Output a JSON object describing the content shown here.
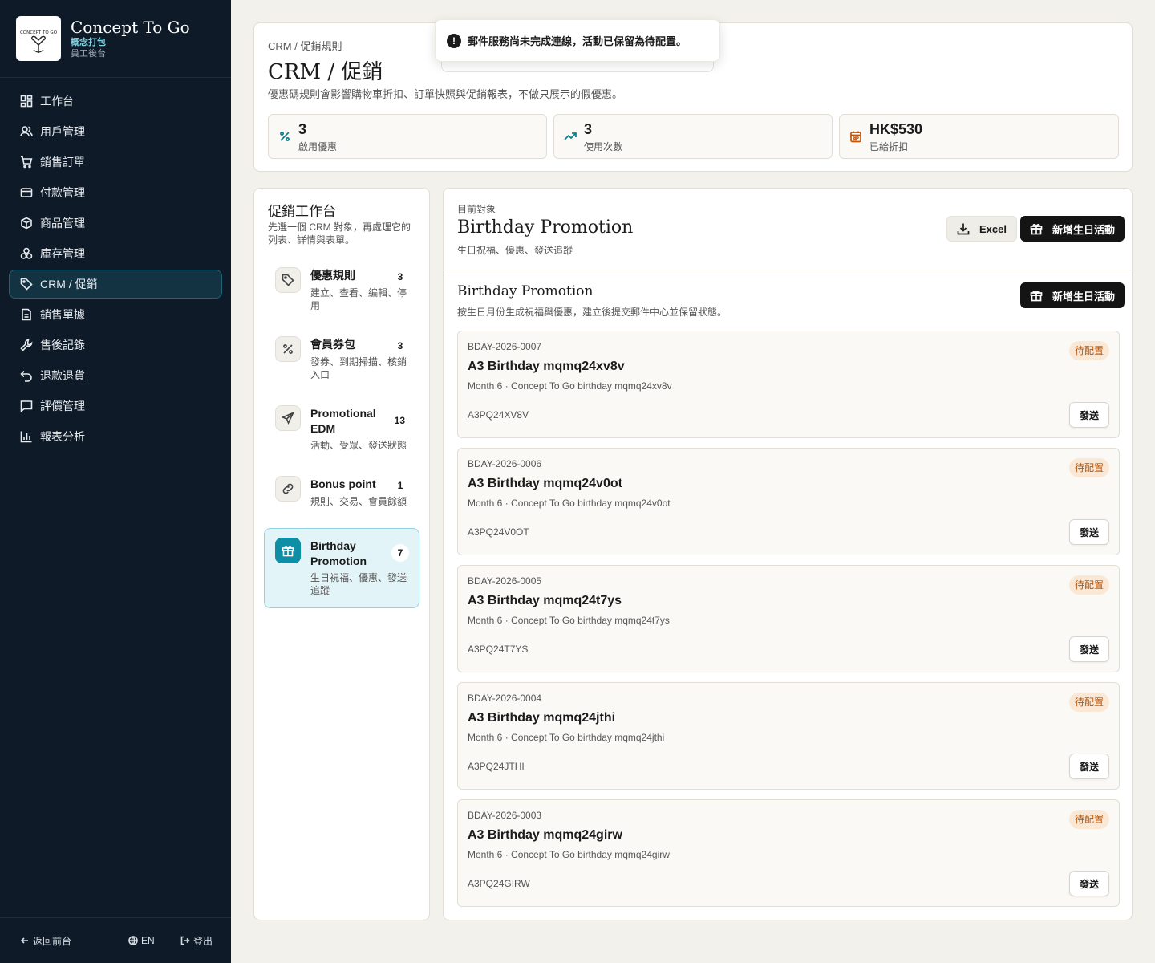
{
  "brand": {
    "name": "Concept To Go",
    "cn": "概念打包",
    "sub": "員工後台",
    "logo_text": "CONCEPT TO GO"
  },
  "nav": [
    {
      "label": "工作台",
      "icon": "dashboard-icon"
    },
    {
      "label": "用戶管理",
      "icon": "users-icon"
    },
    {
      "label": "銷售訂單",
      "icon": "cart-icon"
    },
    {
      "label": "付款管理",
      "icon": "credit-card-icon"
    },
    {
      "label": "商品管理",
      "icon": "box-icon"
    },
    {
      "label": "庫存管理",
      "icon": "boxes-icon"
    },
    {
      "label": "CRM / 促銷",
      "icon": "tag-icon",
      "active": true
    },
    {
      "label": "銷售單據",
      "icon": "file-icon"
    },
    {
      "label": "售後記錄",
      "icon": "wrench-icon"
    },
    {
      "label": "退款退貨",
      "icon": "undo-icon"
    },
    {
      "label": "評價管理",
      "icon": "message-icon"
    },
    {
      "label": "報表分析",
      "icon": "bar-chart-icon"
    }
  ],
  "footer": {
    "back": "返回前台",
    "lang": "EN",
    "logout": "登出"
  },
  "header": {
    "breadcrumb": "CRM / 促銷規則",
    "title": "CRM / 促銷",
    "description": "優惠碼規則會影響購物車折扣、訂單快照與促銷報表，不做只展示的假優惠。",
    "stats": [
      {
        "value": "3",
        "label": "啟用優惠",
        "icon": "percent-icon",
        "color": "#0f7d8f"
      },
      {
        "value": "3",
        "label": "使用次數",
        "icon": "trend-up-icon",
        "color": "#0f7d8f"
      },
      {
        "value": "HK$530",
        "label": "已給折扣",
        "icon": "calendar-icon",
        "color": "#c2570c"
      }
    ]
  },
  "toast": {
    "message": "郵件服務尚未完成連線，活動已保留為待配置。",
    "icon": "!"
  },
  "workbench": {
    "title": "促銷工作台",
    "description": "先選一個 CRM 對象，再處理它的列表、詳情與表單。",
    "items": [
      {
        "label": "優惠規則",
        "sub": "建立、查看、編輯、停用",
        "count": "3",
        "icon": "tag-icon"
      },
      {
        "label": "會員券包",
        "sub": "發券、到期掃描、核銷入口",
        "count": "3",
        "icon": "percent-icon"
      },
      {
        "label": "Promotional EDM",
        "sub": "活動、受眾、發送狀態",
        "count": "13",
        "icon": "send-icon"
      },
      {
        "label": "Bonus point",
        "sub": "規則、交易、會員餘額",
        "count": "1",
        "icon": "link-icon"
      },
      {
        "label": "Birthday Promotion",
        "sub": "生日祝福、優惠、發送追蹤",
        "count": "7",
        "icon": "gift-icon",
        "active": true
      }
    ]
  },
  "main": {
    "object_label": "目前對象",
    "title": "Birthday Promotion",
    "subtitle": "生日祝福、優惠、發送追蹤",
    "excel_label": "Excel",
    "new_label": "新增生日活動",
    "section_title": "Birthday Promotion",
    "section_desc": "按生日月份生成祝福與優惠，建立後提交郵件中心並保留狀態。",
    "send_label": "發送",
    "rows": [
      {
        "code": "BDAY-2026-0007",
        "title": "A3 Birthday mqmq24xv8v",
        "desc": "Month 6 · Concept To Go birthday mqmq24xv8v",
        "ref": "A3PQ24XV8V",
        "status": "待配置"
      },
      {
        "code": "BDAY-2026-0006",
        "title": "A3 Birthday mqmq24v0ot",
        "desc": "Month 6 · Concept To Go birthday mqmq24v0ot",
        "ref": "A3PQ24V0OT",
        "status": "待配置"
      },
      {
        "code": "BDAY-2026-0005",
        "title": "A3 Birthday mqmq24t7ys",
        "desc": "Month 6 · Concept To Go birthday mqmq24t7ys",
        "ref": "A3PQ24T7YS",
        "status": "待配置"
      },
      {
        "code": "BDAY-2026-0004",
        "title": "A3 Birthday mqmq24jthi",
        "desc": "Month 6 · Concept To Go birthday mqmq24jthi",
        "ref": "A3PQ24JTHI",
        "status": "待配置"
      },
      {
        "code": "BDAY-2026-0003",
        "title": "A3 Birthday mqmq24girw",
        "desc": "Month 6 · Concept To Go birthday mqmq24girw",
        "ref": "A3PQ24GIRW",
        "status": "待配置"
      }
    ]
  }
}
